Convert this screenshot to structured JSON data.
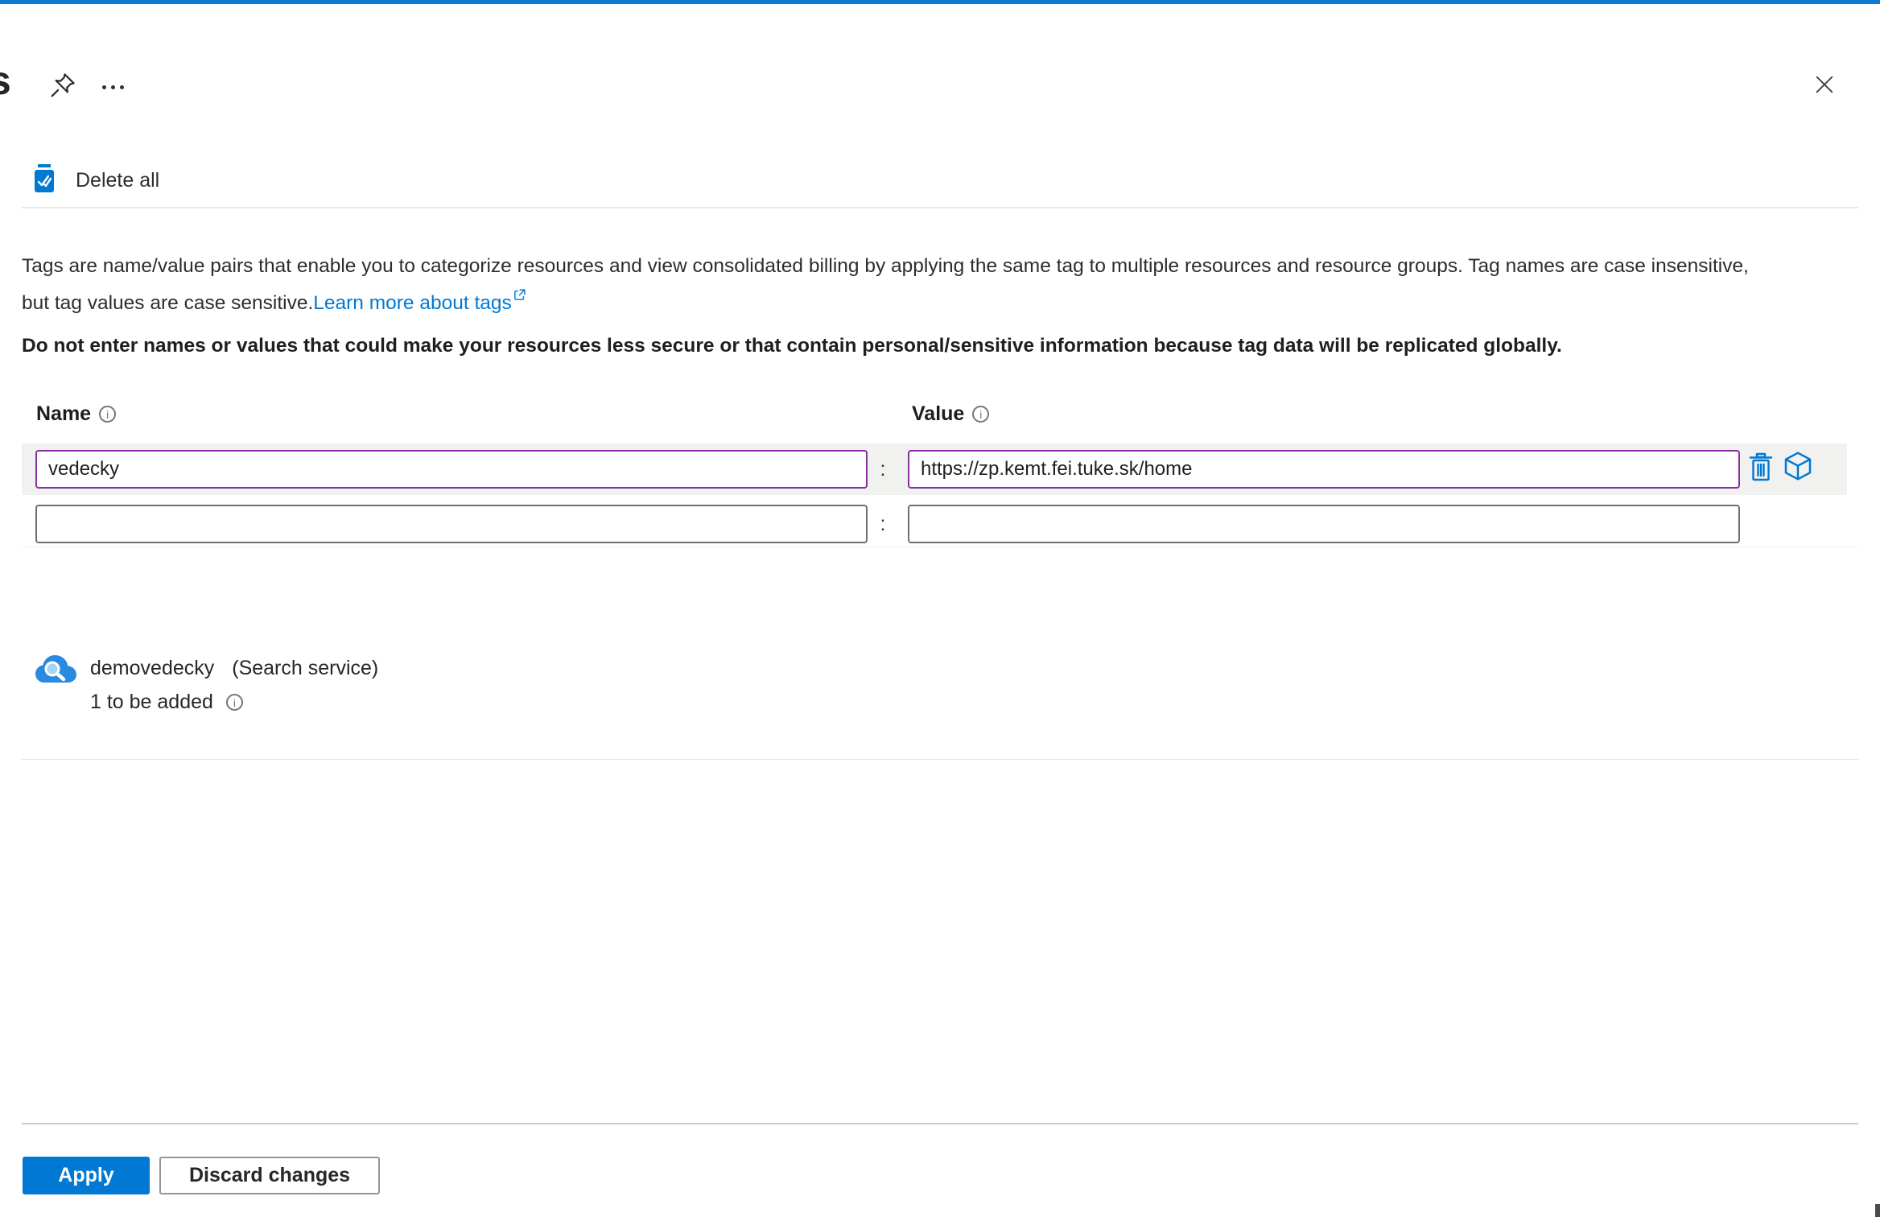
{
  "header": {
    "clipped_title_fragment": "s",
    "pin_icon": "pin-icon",
    "more_icon": "ellipsis-icon",
    "close_icon": "close-icon"
  },
  "toolbar": {
    "delete_all_label": "Delete all"
  },
  "description": {
    "line1": "Tags are name/value pairs that enable you to categorize resources and view consolidated billing by applying the same tag to multiple resources and resource groups. Tag names are case insensitive,",
    "line2": "but tag values are case sensitive.",
    "link_label": "Learn more about tags"
  },
  "warning": "Do not enter names or values that could make your resources less secure or that contain personal/sensitive information because tag data will be replicated globally.",
  "tag_editor": {
    "name_header": "Name",
    "value_header": "Value",
    "separator": ":",
    "rows": [
      {
        "name": "vedecky",
        "value": "https://zp.kemt.fei.tuke.sk/home"
      },
      {
        "name": "",
        "value": ""
      }
    ]
  },
  "resource": {
    "name": "demovedecky",
    "type_label": "(Search service)",
    "pending_label": "1 to be added"
  },
  "footer": {
    "apply_label": "Apply",
    "discard_label": "Discard changes"
  },
  "colors": {
    "accent": "#0078d4",
    "changed_field_border": "#8a2da5",
    "top_bar": "#0f7ad1"
  }
}
